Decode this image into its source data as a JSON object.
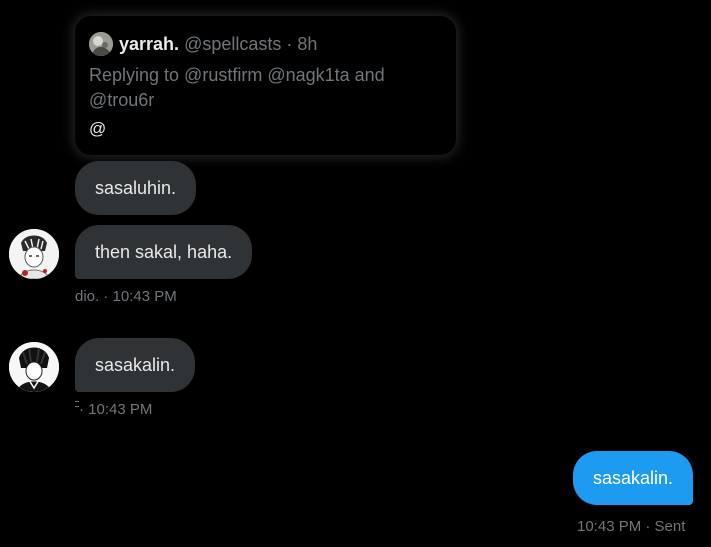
{
  "quote": {
    "name": "yarrah.",
    "handle": "@spellcasts",
    "separator": "·",
    "time": "8h",
    "replying_to": "Replying to @rustfirm @nagk1ta and @trou6r",
    "body": "@"
  },
  "messages": [
    {
      "text": "sasaluhin."
    },
    {
      "text": "then sakal, haha."
    },
    {
      "text": "sasakalin."
    },
    {
      "text": "sasakalin."
    }
  ],
  "meta": [
    {
      "text": "dio. · 10:43 PM"
    },
    {
      "text": "· 10:43 PM"
    },
    {
      "text": "10:43 PM · Sent"
    }
  ],
  "colors": {
    "background": "#000000",
    "received_bubble": "#2f3336",
    "sent_bubble": "#1d9bf0",
    "secondary_text": "#71767b",
    "primary_text": "#e7e9ea"
  }
}
